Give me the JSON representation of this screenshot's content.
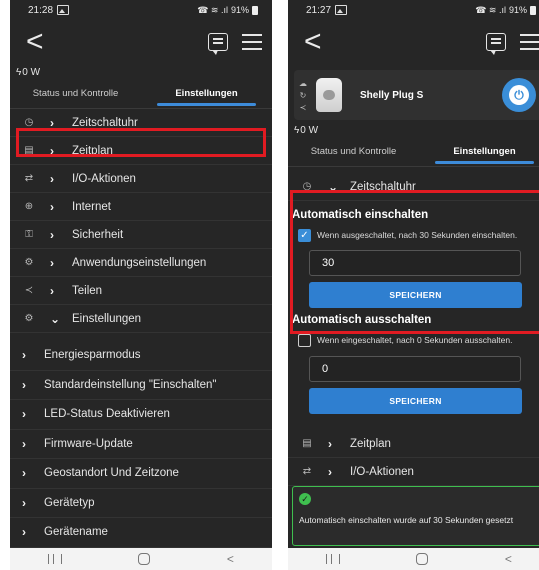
{
  "left": {
    "status": {
      "time": "21:28",
      "signal": "☎ ≋ .ıl",
      "battery": "91%"
    },
    "power": "0 W",
    "tabs": {
      "status": "Status und Kontrolle",
      "settings": "Einstellungen"
    },
    "menu": [
      {
        "icon": "◷",
        "label": "Zeitschaltuhr"
      },
      {
        "icon": "▤",
        "label": "Zeitplan"
      },
      {
        "icon": "⇄",
        "label": "I/O-Aktionen"
      },
      {
        "icon": "⊕",
        "label": "Internet"
      },
      {
        "icon": "⚿",
        "label": "Sicherheit"
      },
      {
        "icon": "⚙",
        "label": "Anwendungseinstellungen"
      },
      {
        "icon": "≺",
        "label": "Teilen"
      },
      {
        "icon": "⚙",
        "label": "Einstellungen"
      }
    ],
    "submenu": [
      "Energiesparmodus",
      "Standardeinstellung \"Einschalten\"",
      "LED-Status Deaktivieren",
      "Firmware-Update",
      "Geostandort Und Zeitzone",
      "Gerätetyp",
      "Gerätename"
    ]
  },
  "right": {
    "status": {
      "time": "21:27",
      "signal": "☎ ≋ .ıl",
      "battery": "91%"
    },
    "device_name": "Shelly Plug S",
    "power": "0 W",
    "tabs": {
      "status": "Status und Kontrolle",
      "settings": "Einstellungen"
    },
    "timer_label": "Zeitschaltuhr",
    "auto_on": {
      "title": "Automatisch einschalten",
      "checkbox_text": "Wenn ausgeschaltet, nach 30 Sekunden einschalten.",
      "value": "30",
      "save": "SPEICHERN"
    },
    "auto_off": {
      "title": "Automatisch ausschalten",
      "checkbox_text": "Wenn eingeschaltet, nach 0 Sekunden ausschalten.",
      "value": "0",
      "save": "SPEICHERN"
    },
    "menu_below": [
      {
        "icon": "▤",
        "label": "Zeitplan"
      },
      {
        "icon": "⇄",
        "label": "I/O-Aktionen"
      }
    ],
    "toast": "Automatisch einschalten wurde auf 30 Sekunden gesetzt"
  }
}
